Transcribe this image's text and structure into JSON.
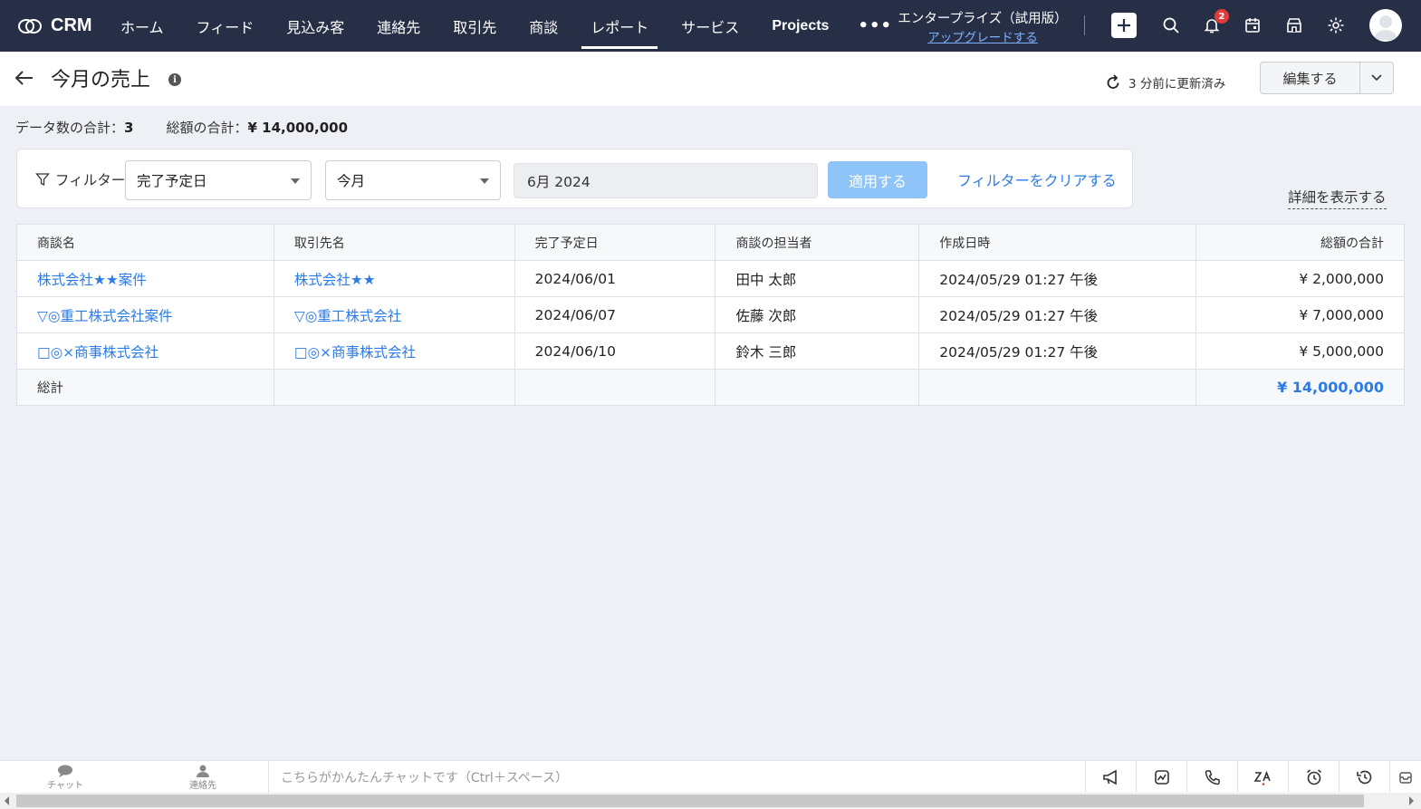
{
  "nav": {
    "brand": "CRM",
    "links": [
      "ホーム",
      "フィード",
      "見込み客",
      "連絡先",
      "取引先",
      "商談",
      "レポート",
      "サービス",
      "Projects"
    ],
    "active_index": 6,
    "more": "•••",
    "edition_name": "エンタープライズ（試用版）",
    "edition_upgrade": "アップグレードする",
    "notification_count": "2"
  },
  "header": {
    "title": "今月の売上",
    "info": "i",
    "refreshed": "3 分前に更新済み",
    "edit_label": "編集する"
  },
  "summary": {
    "count_label": "データ数の合計：",
    "count_value": "3",
    "total_label": "総額の合計：",
    "total_value": "¥ 14,000,000"
  },
  "filter": {
    "label": "フィルター",
    "field": "完了予定日",
    "period": "今月",
    "date": "6月 2024",
    "apply": "適用する",
    "clear": "フィルターをクリアする",
    "details": "詳細を表示する"
  },
  "table": {
    "headers": [
      "商談名",
      "取引先名",
      "完了予定日",
      "商談の担当者",
      "作成日時",
      "総額の合計"
    ],
    "rows": [
      [
        "株式会社★★案件",
        "株式会社★★",
        "2024/06/01",
        "田中 太郎",
        "2024/05/29 01:27 午後",
        "¥ 2,000,000"
      ],
      [
        "▽◎重工株式会社案件",
        "▽◎重工株式会社",
        "2024/06/07",
        "佐藤 次郎",
        "2024/05/29 01:27 午後",
        "¥ 7,000,000"
      ],
      [
        "□◎×商事株式会社",
        "□◎×商事株式会社",
        "2024/06/10",
        "鈴木 三郎",
        "2024/05/29 01:27 午後",
        "¥ 5,000,000"
      ]
    ],
    "total_label": "総計",
    "total_value": "¥ 14,000,000"
  },
  "bottombar": {
    "chat": "チャット",
    "contacts": "連絡先",
    "chat_placeholder": "こちらがかんたんチャットです（Ctrl＋スペース）"
  },
  "colors": {
    "nav_bg": "#262f45",
    "link": "#2d7be5",
    "apply_btn": "#8ec4f7",
    "badge": "#e03c3c"
  }
}
